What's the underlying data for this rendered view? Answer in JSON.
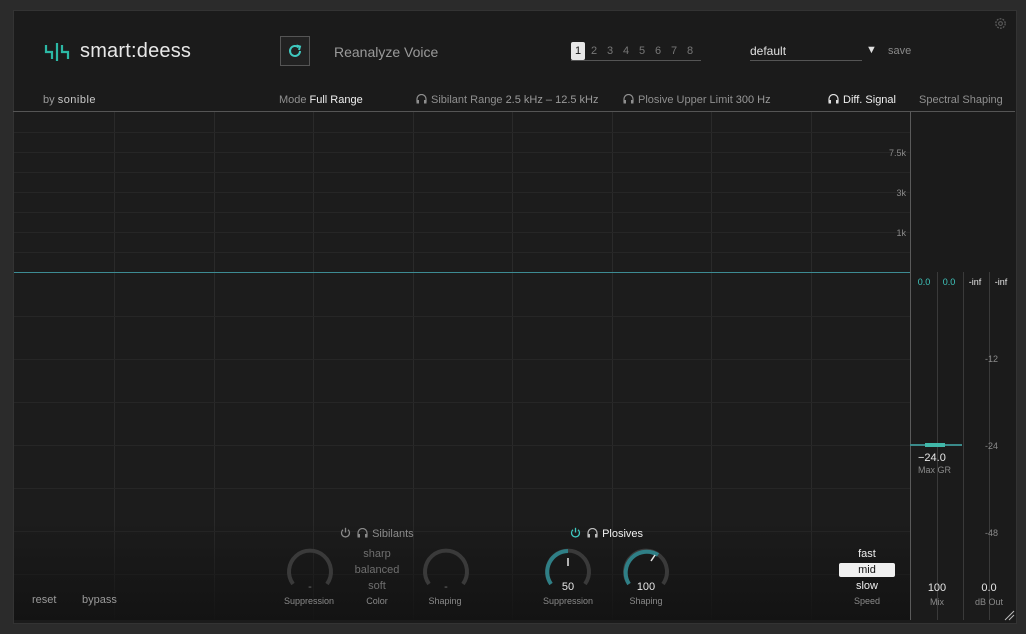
{
  "header": {
    "logo_text": "smart:deess",
    "byline_prefix": "by",
    "byline_brand": "sonible",
    "reanalyze_label": "Reanalyze Voice",
    "slots": [
      "1",
      "2",
      "3",
      "4",
      "5",
      "6",
      "7",
      "8"
    ],
    "active_slot": "1",
    "preset": "default",
    "save_label": "save"
  },
  "options": {
    "mode_label": "Mode",
    "mode_value": "Full Range",
    "sibilant_label": "Sibilant Range",
    "sibilant_value": "2.5 kHz – 12.5 kHz",
    "plosive_label": "Plosive Upper Limit",
    "plosive_value": "300 Hz",
    "diff_label": "Diff. Signal",
    "spectral_label": "Spectral Shaping"
  },
  "graph": {
    "freq_labels": [
      "7.5k",
      "3k",
      "1k"
    ],
    "db_labels": [
      "-12",
      "-24",
      "-48"
    ]
  },
  "meters": {
    "values": [
      "0.0",
      "0.0",
      "-inf",
      "-inf"
    ],
    "max_gr_value": "−24.0",
    "max_gr_label": "Max GR"
  },
  "sibilants": {
    "title": "Sibilants",
    "suppression_value": "-",
    "suppression_label": "Suppression",
    "color_options": [
      "sharp",
      "balanced",
      "soft"
    ],
    "color_label": "Color",
    "shaping_value": "-",
    "shaping_label": "Shaping"
  },
  "plosives": {
    "title": "Plosives",
    "suppression_value": "50",
    "suppression_label": "Suppression",
    "shaping_value": "100",
    "shaping_label": "Shaping"
  },
  "speed": {
    "options": [
      "fast",
      "mid",
      "slow"
    ],
    "selected": "mid",
    "label": "Speed"
  },
  "footer": {
    "reset_label": "reset",
    "bypass_label": "bypass",
    "mix_value": "100",
    "mix_label": "Mix",
    "out_value": "0.0",
    "out_label": "dB Out"
  },
  "colors": {
    "accent": "#3fc9c0",
    "knob_track": "#3a3a3a",
    "knob_active": "#2f7f86"
  },
  "icons": [
    "settings-gear-icon",
    "reanalyze-icon",
    "headphones-icon",
    "power-icon",
    "resize-handle-icon",
    "logo-icon"
  ]
}
